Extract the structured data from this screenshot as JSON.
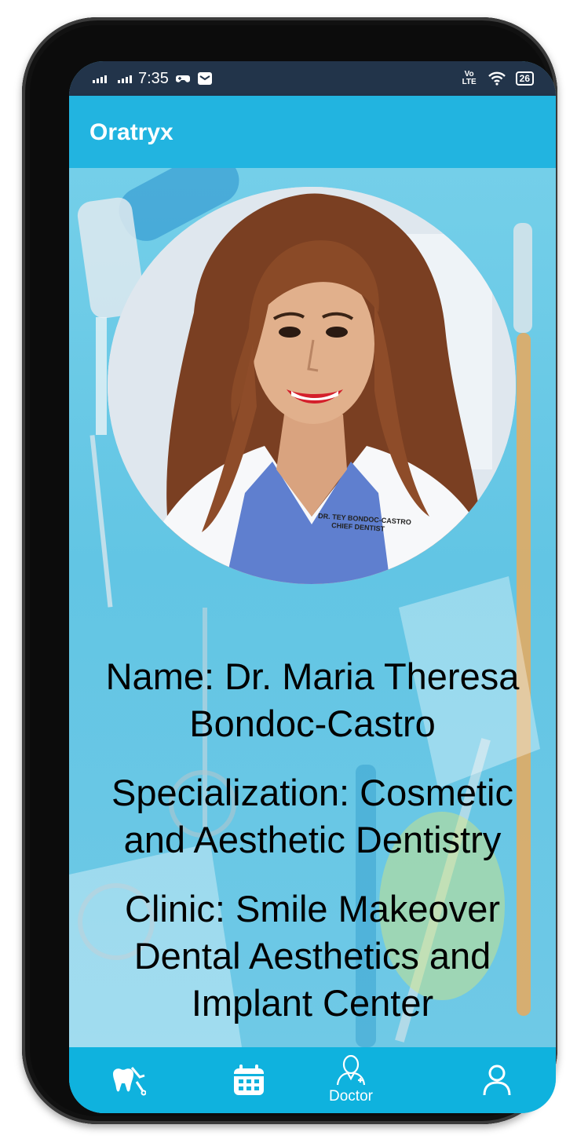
{
  "status_bar": {
    "time": "7:35",
    "battery": "26",
    "network_label": "Vo LTE"
  },
  "app_bar": {
    "title": "Oratryx"
  },
  "doctor": {
    "coat_name": "DR. TEY BONDOC-CASTRO",
    "coat_title": "CHIEF DENTIST",
    "name": "Name: Dr. Maria Theresa Bondoc-Castro",
    "specialization": "Specialization: Cosmetic and Aesthetic Dentistry",
    "clinic": "Clinic: Smile Makeover Dental Aesthetics and Implant Center"
  },
  "bottom_nav": {
    "items": [
      {
        "icon": "tooth-tools-icon",
        "label": ""
      },
      {
        "icon": "calendar-icon",
        "label": ""
      },
      {
        "icon": "doctor-icon",
        "label": "Doctor",
        "active": true
      },
      {
        "icon": "profile-icon",
        "label": ""
      }
    ]
  },
  "colors": {
    "status_bar": "#22344a",
    "app_bar": "#22b4e0",
    "bottom_nav": "#0fb2de",
    "background": "#62c5e4"
  }
}
